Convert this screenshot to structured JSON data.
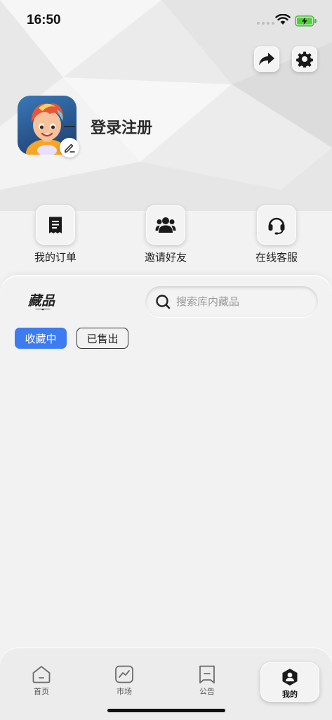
{
  "status_bar": {
    "time": "16:50"
  },
  "header": {
    "share_icon": "share-arrow-icon",
    "settings_icon": "gear-icon",
    "login_label": "登录注册"
  },
  "actions": [
    {
      "label": "我的订单",
      "icon": "receipt-icon"
    },
    {
      "label": "邀请好友",
      "icon": "users-icon"
    },
    {
      "label": "在线客服",
      "icon": "headset-icon"
    }
  ],
  "collection": {
    "title": "藏品",
    "search_placeholder": "搜索库内藏品",
    "filters": [
      {
        "label": "收藏中",
        "active": true
      },
      {
        "label": "已售出",
        "active": false
      }
    ]
  },
  "tabbar": {
    "tabs": [
      {
        "label": "首页",
        "icon": "home-icon"
      },
      {
        "label": "市场",
        "icon": "chart-icon"
      },
      {
        "label": "公告",
        "icon": "notice-icon"
      },
      {
        "label": "我的",
        "icon": "profile-icon",
        "active": true
      }
    ]
  },
  "colors": {
    "accent": "#3d7cf0",
    "background": "#f2f2f2"
  }
}
